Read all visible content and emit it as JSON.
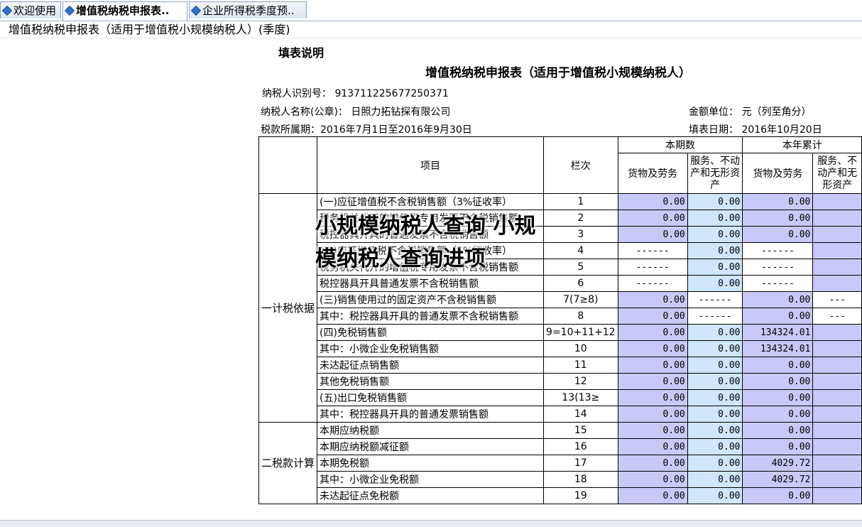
{
  "tabs": [
    {
      "label": "欢迎使用"
    },
    {
      "label": "增值税纳税申报表.."
    },
    {
      "label": "企业所得税季度预.."
    }
  ],
  "subtitle": "增值税纳税申报表（适用于增值税小规模纳税人）(季度)",
  "fill_note": "填表说明",
  "form_title": "增值税纳税申报表（适用于增值税小规模纳税人）",
  "taxpayer_id": "纳税人识别号： 913711225677250371",
  "taxpayer_name": "纳税人名称(公章)： 日照力拓钻探有限公司",
  "amount_unit": "金额单位： 元（列至角分）",
  "period": "税款所属期：2016年7月1日至2016年9月30日",
  "fill_date": "填表日期： 2016年10月20日",
  "headers": {
    "current_period": "本期数",
    "year_total": "本年累计",
    "item": "项目",
    "column": "栏次",
    "goods": "货物及劳务",
    "services": "服务、不动产和无形资产",
    "goods_ytd": "货物及劳务",
    "services_ytd": "服务、不动产和无形资产"
  },
  "section1": "一计税依据",
  "section2": "二税款计算",
  "rows": [
    {
      "item": "(一)应征增值税不含税销售额（3%征收率）",
      "no": "1",
      "a": "0.00",
      "b": "0.00",
      "c": "0.00"
    },
    {
      "item": "税务机关代开的增值税专用发票不含税销售额",
      "no": "2",
      "a": "0.00",
      "b": "0.00",
      "c": "0.00"
    },
    {
      "item": "税控器具开具的普通发票不含税销售额",
      "no": "3",
      "a": "0.00",
      "b": "0.00",
      "c": "0.00"
    },
    {
      "item": "(二)应征增值税不含税销售额（5%征收率）",
      "no": "4",
      "a": "------",
      "b": "0.00",
      "c": "------"
    },
    {
      "item": "税务机关代开的增值税专用发票不含税销售额",
      "no": "5",
      "a": "------",
      "b": "0.00",
      "c": "------"
    },
    {
      "item": "税控器具开具普通发票不含税销售额",
      "no": "6",
      "a": "------",
      "b": "0.00",
      "c": "------"
    },
    {
      "item": "(三)销售使用过的固定资产不含税销售额",
      "no": "7(7≥8)",
      "a": "0.00",
      "b": "------",
      "c": "0.00"
    },
    {
      "item": "其中：税控器具开具的普通发票不含税销售额",
      "no": "8",
      "a": "0.00",
      "b": "------",
      "c": "0.00"
    },
    {
      "item": "(四)免税销售额",
      "no": "9=10+11+12",
      "a": "0.00",
      "b": "0.00",
      "c": "134324.01"
    },
    {
      "item": "其中：小微企业免税销售额",
      "no": "10",
      "a": "0.00",
      "b": "0.00",
      "c": "134324.01"
    },
    {
      "item": "未达起征点销售额",
      "no": "11",
      "a": "0.00",
      "b": "0.00",
      "c": "0.00"
    },
    {
      "item": "其他免税销售额",
      "no": "12",
      "a": "0.00",
      "b": "0.00",
      "c": "0.00"
    },
    {
      "item": "(五)出口免税销售额",
      "no": "13(13≥",
      "a": "0.00",
      "b": "0.00",
      "c": "0.00"
    },
    {
      "item": "其中：税控器具开具的普通发票销售额",
      "no": "14",
      "a": "0.00",
      "b": "0.00",
      "c": "0.00"
    },
    {
      "item": "本期应纳税额",
      "no": "15",
      "a": "0.00",
      "b": "0.00",
      "c": "0.00"
    },
    {
      "item": "本期应纳税额减征额",
      "no": "16",
      "a": "0.00",
      "b": "0.00",
      "c": "0.00"
    },
    {
      "item": "本期免税额",
      "no": "17",
      "a": "0.00",
      "b": "0.00",
      "c": "4029.72"
    },
    {
      "item": "其中：小微企业免税额",
      "no": "18",
      "a": "0.00",
      "b": "0.00",
      "c": "4029.72"
    },
    {
      "item": "未达起征点免税额",
      "no": "19",
      "a": "0.00",
      "b": "0.00",
      "c": "0.00"
    }
  ],
  "col_d_dash": "---",
  "watermark": "小规模纳税人查询 小规模纳税人查询进项"
}
